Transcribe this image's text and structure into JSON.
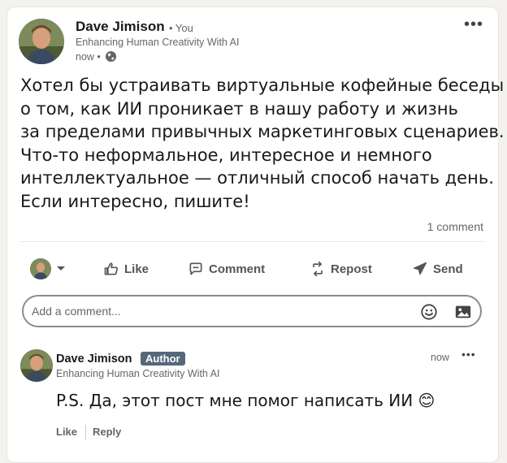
{
  "post": {
    "author_name": "Dave Jimison",
    "author_tag": "• You",
    "headline": "Enhancing Human Creativity With AI",
    "time": "now •",
    "more": "•••",
    "text_lines": [
      "Хотел бы устраивать виртуальные кофейные беседы",
      "о том, как ИИ проникает в нашу работу и жизнь",
      "за пределами привычных маркетинговых сценариев.",
      "Что-то неформальное, интересное и немного",
      "интеллектуальное — отличный способ начать день.",
      "Если интересно, пишите!"
    ],
    "comment_count": "1 comment"
  },
  "actions": {
    "like": "Like",
    "comment": "Comment",
    "repost": "Repost",
    "send": "Send"
  },
  "comment_input": {
    "placeholder": "Add a comment..."
  },
  "reply": {
    "author_name": "Dave Jimison",
    "badge": "Author",
    "headline": "Enhancing Human Creativity With AI",
    "time": "now",
    "more": "•••",
    "text": "P.S. Да, этот пост мне помог написать ИИ 😊",
    "like": "Like",
    "reply": "Reply"
  },
  "colors": {
    "accent_badge": "#56687a",
    "action_text": "#555555"
  }
}
